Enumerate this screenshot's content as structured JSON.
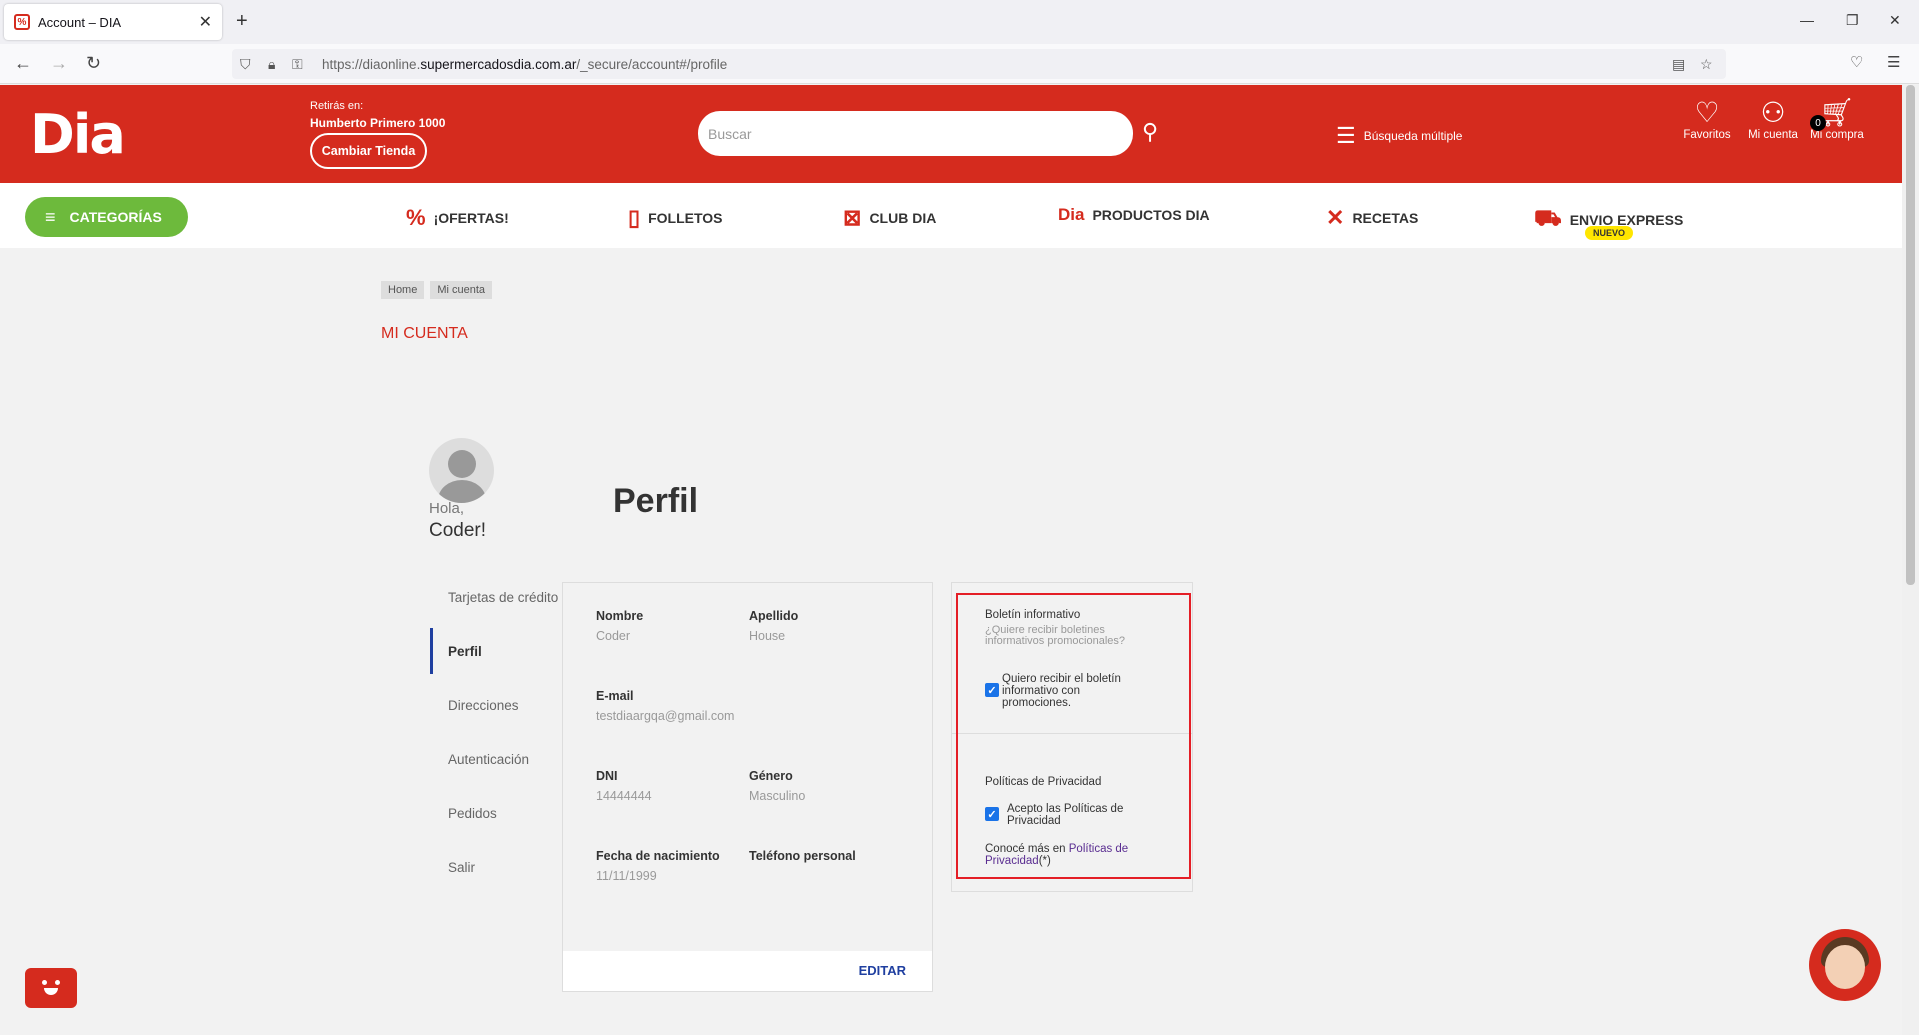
{
  "browser": {
    "tab_title": "Account – DIA",
    "url_prefix": "https://diaonline.",
    "url_domain": "supermercadosdia.com.ar",
    "url_path": "/_secure/account#/profile"
  },
  "header": {
    "logo": "Dia",
    "store_label": "Retirás en:",
    "store_name": "Humberto Primero 1000",
    "change_store": "Cambiar Tienda",
    "search_placeholder": "Buscar",
    "multi_search": "Búsqueda múltiple",
    "favorites": "Favoritos",
    "account": "Mi cuenta",
    "cart": "Mi compra",
    "cart_count": "0"
  },
  "menu": {
    "categories": "CATEGORÍAS",
    "offers": "¡OFERTAS!",
    "flyers": "FOLLETOS",
    "club": "CLUB DIA",
    "products_logo": "Dia",
    "products": "PRODUCTOS DIA",
    "recipes": "RECETAS",
    "express": "ENVIO EXPRESS",
    "express_badge": "NUEVO"
  },
  "breadcrumb": [
    "Home",
    "Mi cuenta"
  ],
  "page_title": "MI CUENTA",
  "user": {
    "greeting": "Hola,",
    "name": "Coder!"
  },
  "heading": "Perfil",
  "side_menu": [
    "Tarjetas de crédito",
    "Perfil",
    "Direcciones",
    "Autenticación",
    "Pedidos",
    "Salir"
  ],
  "profile": {
    "name_label": "Nombre",
    "name": "Coder",
    "surname_label": "Apellido",
    "surname": "House",
    "email_label": "E-mail",
    "email": "testdiaargqa@gmail.com",
    "dni_label": "DNI",
    "dni": "14444444",
    "gender_label": "Género",
    "gender": "Masculino",
    "birth_label": "Fecha de nacimiento",
    "birth": "11/11/1999",
    "phone_label": "Teléfono personal",
    "edit": "EDITAR"
  },
  "newsletter": {
    "title": "Boletín informativo",
    "subtitle": "¿Quiere recibir boletines informativos promocionales?",
    "check_label": "Quiero recibir el boletín informativo con promociones.",
    "checked": true,
    "policy_title": "Políticas de Privacidad",
    "policy_check": "Acepto las Políticas de Privacidad",
    "policy_checked": true,
    "more_prefix": "Conocé más en ",
    "more_link": "Políticas de Privacidad",
    "more_suffix": "(*)"
  },
  "colors": {
    "brand": "#d52b1e",
    "green": "#6dba3c",
    "active": "#1f3fa0",
    "highlight": "#e41e26"
  },
  "icons": [
    "back-icon",
    "forward-icon",
    "reload-icon",
    "shield-icon",
    "lock-icon",
    "key-icon",
    "reader-icon",
    "star-icon",
    "pocket-icon",
    "menu-icon",
    "search-icon",
    "multi-search-icon",
    "heart-icon",
    "user-icon",
    "cart-icon",
    "hamburger-icon",
    "percent-icon",
    "flyer-icon",
    "club-icon",
    "fork-knife-icon",
    "scooter-icon",
    "check-icon"
  ]
}
